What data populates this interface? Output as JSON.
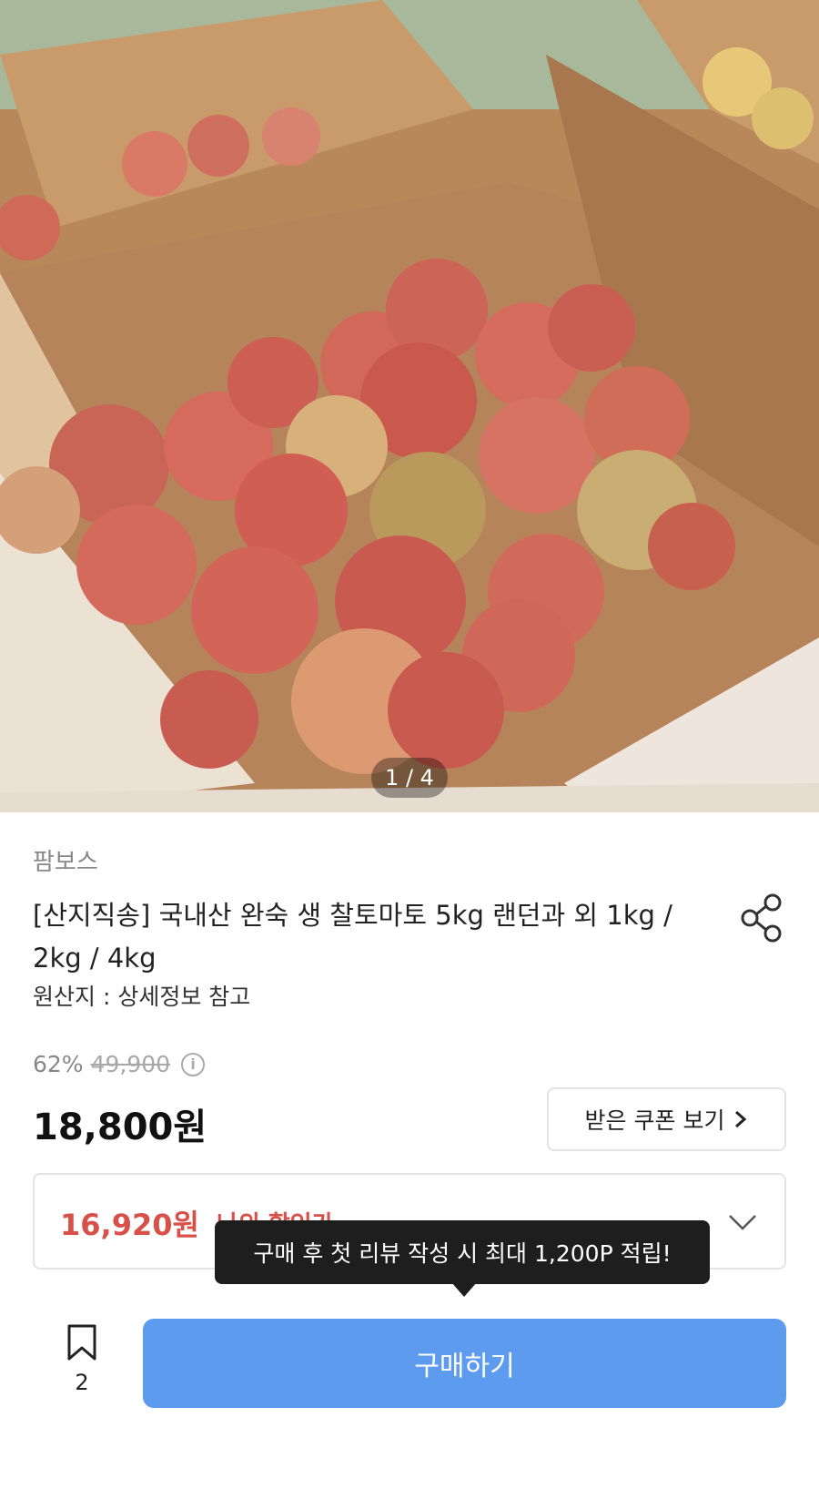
{
  "gallery": {
    "counter": "1 / 4"
  },
  "product": {
    "seller": "팜보스",
    "title": "[산지직송] 국내산 완숙 생 찰토마토 5kg 랜던과 외 1kg / 2kg / 4kg",
    "origin": "원산지 : 상세정보 참고"
  },
  "pricing": {
    "discount_rate": "62%",
    "original_price": "49,900",
    "price": "18,800원",
    "coupon_button": "받은 쿠폰 보기",
    "member_price": "16,920원",
    "member_label": "나의 할인가"
  },
  "tooltip": "구매 후 첫 리뷰 작성 시 최대 1,200P 적립!",
  "bottom_bar": {
    "bookmark_count": "2",
    "buy_button": "구매하기"
  },
  "colors": {
    "buy_button": "#5d9bee",
    "member_price": "#d8504a",
    "tooltip_bg": "#1e1e1e"
  }
}
